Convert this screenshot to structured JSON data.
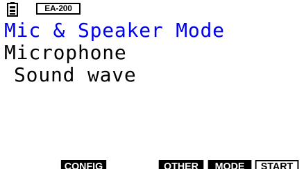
{
  "status_bar": {
    "battery_icon": "battery-icon",
    "device_label": "EA-200"
  },
  "screen": {
    "title": "Mic & Speaker Mode",
    "mode": "Microphone",
    "option": "Sound wave"
  },
  "fkeys": {
    "f2": "CONFIG",
    "f4": "OTHER",
    "f5": "MODE",
    "f6": "START"
  },
  "colors": {
    "title": "#0000ee",
    "text": "#000000",
    "background": "#ffffff"
  }
}
